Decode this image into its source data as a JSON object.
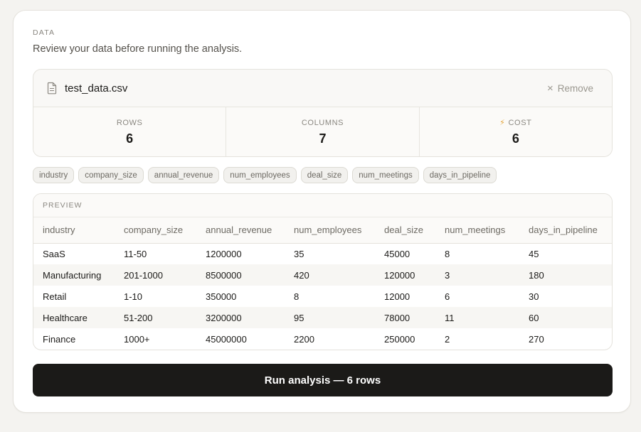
{
  "section_label": "DATA",
  "subtitle": "Review your data before running the analysis.",
  "file": {
    "name": "test_data.csv",
    "remove_label": "Remove"
  },
  "stats": [
    {
      "label": "ROWS",
      "value": "6"
    },
    {
      "label": "COLUMNS",
      "value": "7"
    },
    {
      "label": "COST",
      "value": "6"
    }
  ],
  "chips": [
    "industry",
    "company_size",
    "annual_revenue",
    "num_employees",
    "deal_size",
    "num_meetings",
    "days_in_pipeline"
  ],
  "preview": {
    "label": "PREVIEW",
    "columns": [
      "industry",
      "company_size",
      "annual_revenue",
      "num_employees",
      "deal_size",
      "num_meetings",
      "days_in_pipeline"
    ],
    "rows": [
      [
        "SaaS",
        "11-50",
        "1200000",
        "35",
        "45000",
        "8",
        "45"
      ],
      [
        "Manufacturing",
        "201-1000",
        "8500000",
        "420",
        "120000",
        "3",
        "180"
      ],
      [
        "Retail",
        "1-10",
        "350000",
        "8",
        "12000",
        "6",
        "30"
      ],
      [
        "Healthcare",
        "51-200",
        "3200000",
        "95",
        "78000",
        "11",
        "60"
      ],
      [
        "Finance",
        "1000+",
        "45000000",
        "2200",
        "250000",
        "2",
        "270"
      ]
    ]
  },
  "run_button_label": "Run analysis — 6 rows",
  "colors": {
    "accent_bolt": "#e2a33a",
    "button_bg": "#1b1a18"
  }
}
